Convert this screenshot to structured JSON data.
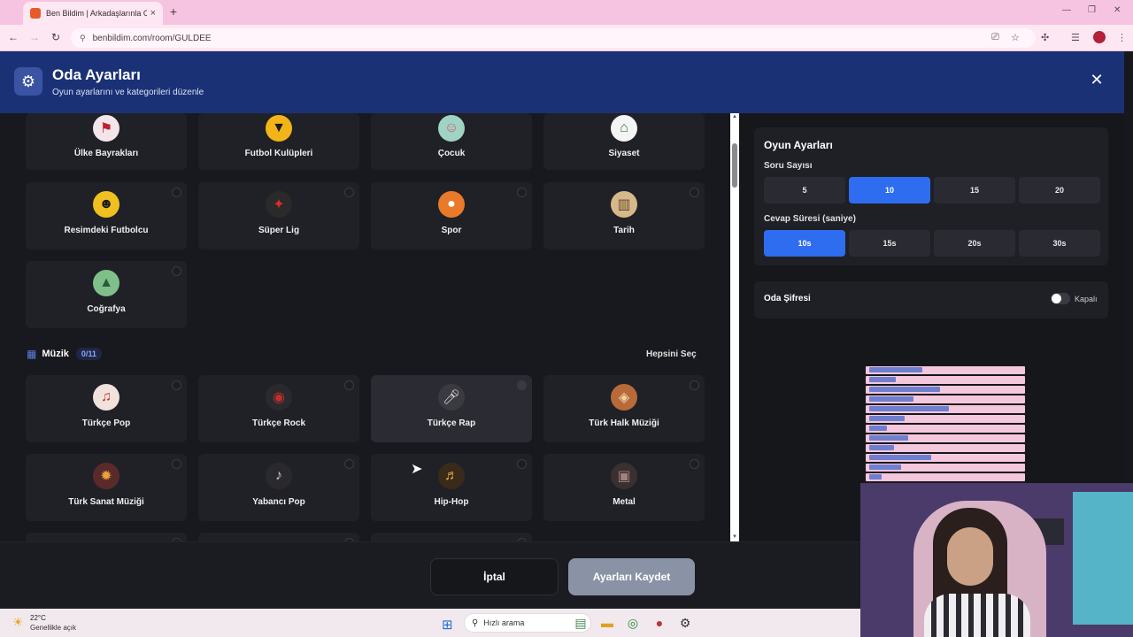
{
  "browser": {
    "tab_title": "Ben Bildim | Arkadaşlarınla Or...",
    "tab_close": "×",
    "new_tab": "+",
    "url": "benbildim.com/room/GULDEE"
  },
  "modal": {
    "title": "Oda Ayarları",
    "subtitle": "Oyun ayarlarını ve kategorileri düzenle",
    "close": "✕"
  },
  "categories_top": [
    {
      "label": "Ülke Bayrakları",
      "icon": "flag-icon"
    },
    {
      "label": "Futbol Kulüpleri",
      "icon": "wolf-icon"
    },
    {
      "label": "Çocuk",
      "icon": "child-icon"
    },
    {
      "label": "Siyaset",
      "icon": "government-icon"
    },
    {
      "label": "Resimdeki Futbolcu",
      "icon": "footballer-icon"
    },
    {
      "label": "Süper Lig",
      "icon": "league-icon"
    },
    {
      "label": "Spor",
      "icon": "ball-icon"
    },
    {
      "label": "Tarih",
      "icon": "colosseum-icon"
    },
    {
      "label": "Coğrafya",
      "icon": "mountain-icon"
    }
  ],
  "music_section": {
    "name": "Müzik",
    "count": "0/11",
    "select_all": "Hepsini Seç",
    "items": [
      {
        "label": "Türkçe Pop",
        "icon": "pop-icon"
      },
      {
        "label": "Türkçe Rock",
        "icon": "vinyl-icon"
      },
      {
        "label": "Türkçe Rap",
        "icon": "microphone-icon"
      },
      {
        "label": "Türk Halk Müziği",
        "icon": "saz-icon"
      },
      {
        "label": "Türk Sanat Müziği",
        "icon": "ornament-icon"
      },
      {
        "label": "Yabancı Pop",
        "icon": "guitar-icon"
      },
      {
        "label": "Hip-Hop",
        "icon": "hiphop-icon"
      },
      {
        "label": "Metal",
        "icon": "metal-icon"
      }
    ]
  },
  "game_settings": {
    "title": "Oyun Ayarları",
    "question_count_label": "Soru Sayısı",
    "question_counts": [
      "5",
      "10",
      "15",
      "20"
    ],
    "question_count_selected": "10",
    "answer_time_label": "Cevap Süresi (saniye)",
    "answer_times": [
      "10s",
      "15s",
      "20s",
      "30s"
    ],
    "answer_time_selected": "10s"
  },
  "room_password": {
    "label": "Oda Şifresi",
    "state": "Kapalı"
  },
  "footer": {
    "cancel": "İptal",
    "save": "Ayarları Kaydet"
  },
  "taskbar": {
    "temperature": "22°C",
    "weather": "Genellikle açık",
    "search_placeholder": "Hızlı arama"
  }
}
